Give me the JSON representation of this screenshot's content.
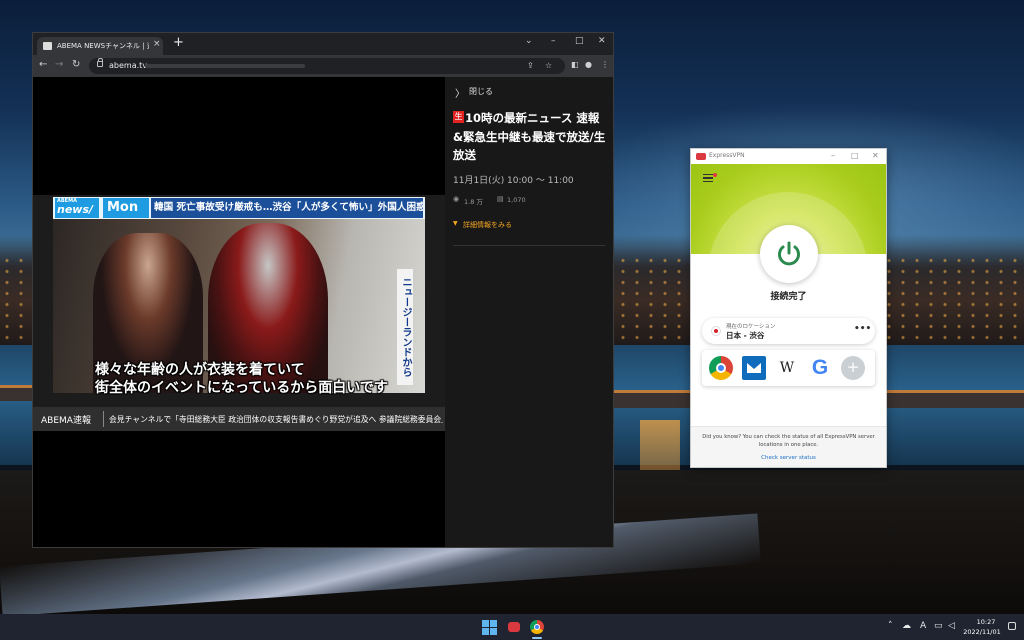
{
  "browser": {
    "tab_title": "ABEMA NEWSチャンネル | 速報ニ",
    "url": "abema.tv",
    "new_tab": "+",
    "tab_close": "×"
  },
  "video": {
    "logo_brand": "ABEMA",
    "logo_name": "news/",
    "day": "Mon",
    "headline": "韓国 死亡事故受け厳戒も…渋谷「人が多くて怖い」外国人困惑",
    "side_caption": "ニュージーランドから",
    "subtitle_line1": "様々な年齢の人が衣装を着ていて",
    "subtitle_line2": "街全体のイベントになっているから面白いです",
    "ticker_label": "ABEMA速報",
    "ticker_text": "会見チャンネルで「寺田総務大臣 政治団体の収支報告書めぐり野党が追及へ 参議院総務委員会」を放送中"
  },
  "side_panel": {
    "close_label": "閉じる",
    "live_badge": "生",
    "program_title": "10時の最新ニュース 速報&緊急生中継も最速で放送/生放送",
    "date_time": "11月1日(火) 10:00 〜 11:00",
    "views": "1.8 万",
    "comments": "1,070",
    "details_label": "詳細情報をみる"
  },
  "vpn": {
    "window_title": "ExpressVPN",
    "status": "接続完了",
    "location_caption": "現在のロケーション",
    "location_name": "日本 - 渋谷",
    "more": "•••",
    "wiki_glyph": "W",
    "google_glyph": "G",
    "add_glyph": "+",
    "tip": "Did you know? You can check the status of all ExpressVPN server locations in one place.",
    "link": "Check server status",
    "accent_color": "#da3940",
    "hero_color": "#a8cc1c"
  },
  "taskbar": {
    "time": "10:27",
    "date": "2022/11/01",
    "ime": "A"
  }
}
